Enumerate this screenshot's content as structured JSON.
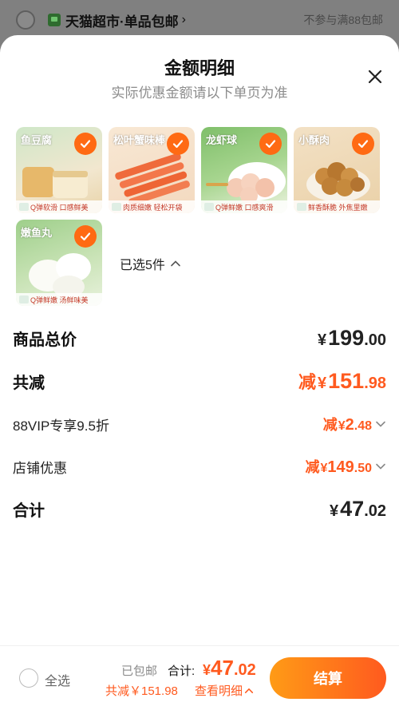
{
  "background": {
    "store_name": "天猫超市·单品包邮",
    "store_right": "不参与满88包邮"
  },
  "sheet": {
    "title": "金额明细",
    "subtitle": "实际优惠金额请以下单页为准"
  },
  "products": [
    {
      "label": "鱼豆腐",
      "caption": "Q弹软滑 口感鲜美"
    },
    {
      "label": "松叶蟹味棒",
      "caption": "肉质细嫩 轻松开袋"
    },
    {
      "label": "龙虾球",
      "caption": "Q弹鲜嫩 口感爽滑"
    },
    {
      "label": "小酥肉",
      "caption": "鲜香酥脆 外焦里嫩"
    },
    {
      "label": "嫩鱼丸",
      "caption": "Q弹鲜嫩 汤鲜味美"
    }
  ],
  "selected_count": "已选5件",
  "rows": {
    "total_price": {
      "label": "商品总价",
      "currency": "¥",
      "int": "199",
      "dec": ".00"
    },
    "total_reduce": {
      "label": "共减",
      "prefix": "减",
      "currency": "¥",
      "int": "151",
      "dec": ".98"
    },
    "vip": {
      "label": "88VIP专享9.5折",
      "prefix": "减",
      "currency": "¥",
      "int": "2",
      "dec": ".48"
    },
    "store": {
      "label": "店铺优惠",
      "prefix": "减",
      "currency": "¥",
      "int": "149",
      "dec": ".50"
    },
    "sum": {
      "label": "合计",
      "currency": "¥",
      "int": "47",
      "dec": ".02"
    }
  },
  "bottom": {
    "select_all": "全选",
    "shipping": "已包邮",
    "total_label": "合计:",
    "total_currency": "¥",
    "total_int": "47",
    "total_dec": ".02",
    "reduce_text": "共减￥151.98",
    "view_detail": "查看明细",
    "checkout": "结算"
  },
  "colors": {
    "accent": "#ff5a1f",
    "button_gradient_start": "#ff9b16",
    "button_gradient_end": "#ff5a1f"
  }
}
